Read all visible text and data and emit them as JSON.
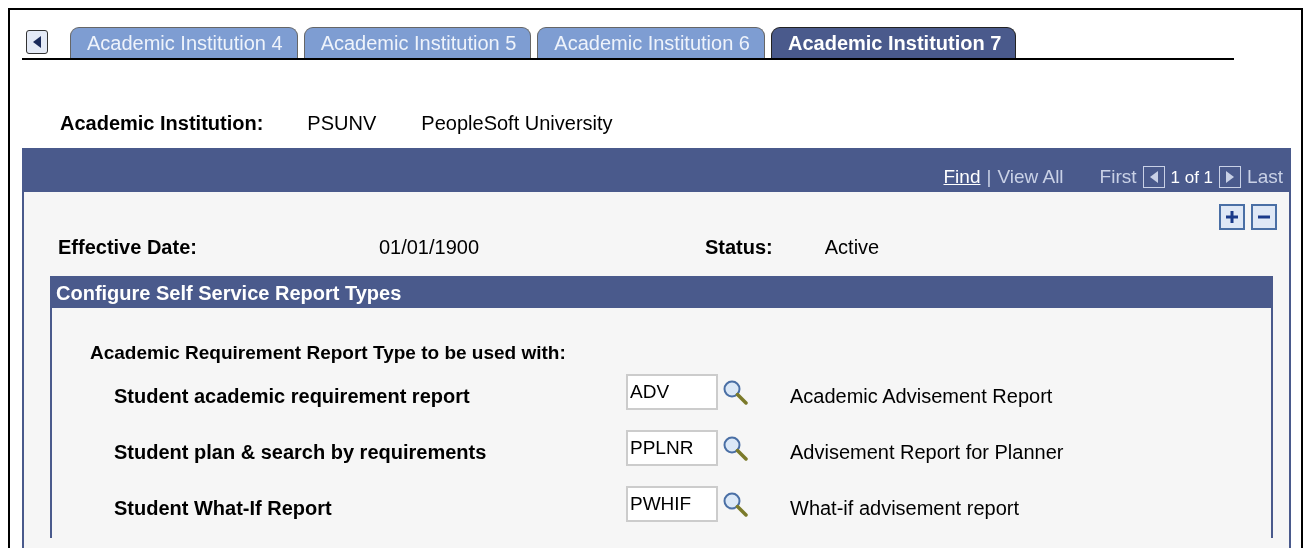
{
  "tabs": [
    {
      "label": "Academic Institution 4",
      "selected": false
    },
    {
      "label": "Academic Institution 5",
      "selected": false
    },
    {
      "label": "Academic Institution 6",
      "selected": false
    },
    {
      "label": "Academic Institution 7",
      "selected": true
    }
  ],
  "institution": {
    "label": "Academic Institution:",
    "code": "PSUNV",
    "name": "PeopleSoft University"
  },
  "navigation": {
    "find": "Find",
    "separator": "|",
    "view_all": "View All",
    "first": "First",
    "count": "1 of 1",
    "last": "Last"
  },
  "effective_date": {
    "label": "Effective Date:",
    "value": "01/01/1900"
  },
  "status": {
    "label": "Status:",
    "value": "Active"
  },
  "section": {
    "title": "Configure Self Service Report Types",
    "intro": "Academic Requirement Report Type to be used with:",
    "rows": [
      {
        "label": "Student academic requirement report",
        "value": "ADV",
        "description": "Academic Advisement Report"
      },
      {
        "label": "Student plan & search by requirements",
        "value": "PPLNR",
        "description": "Advisement Report for Planner"
      },
      {
        "label": "Student What-If Report",
        "value": "PWHIF",
        "description": "What-if advisement report"
      }
    ]
  }
}
